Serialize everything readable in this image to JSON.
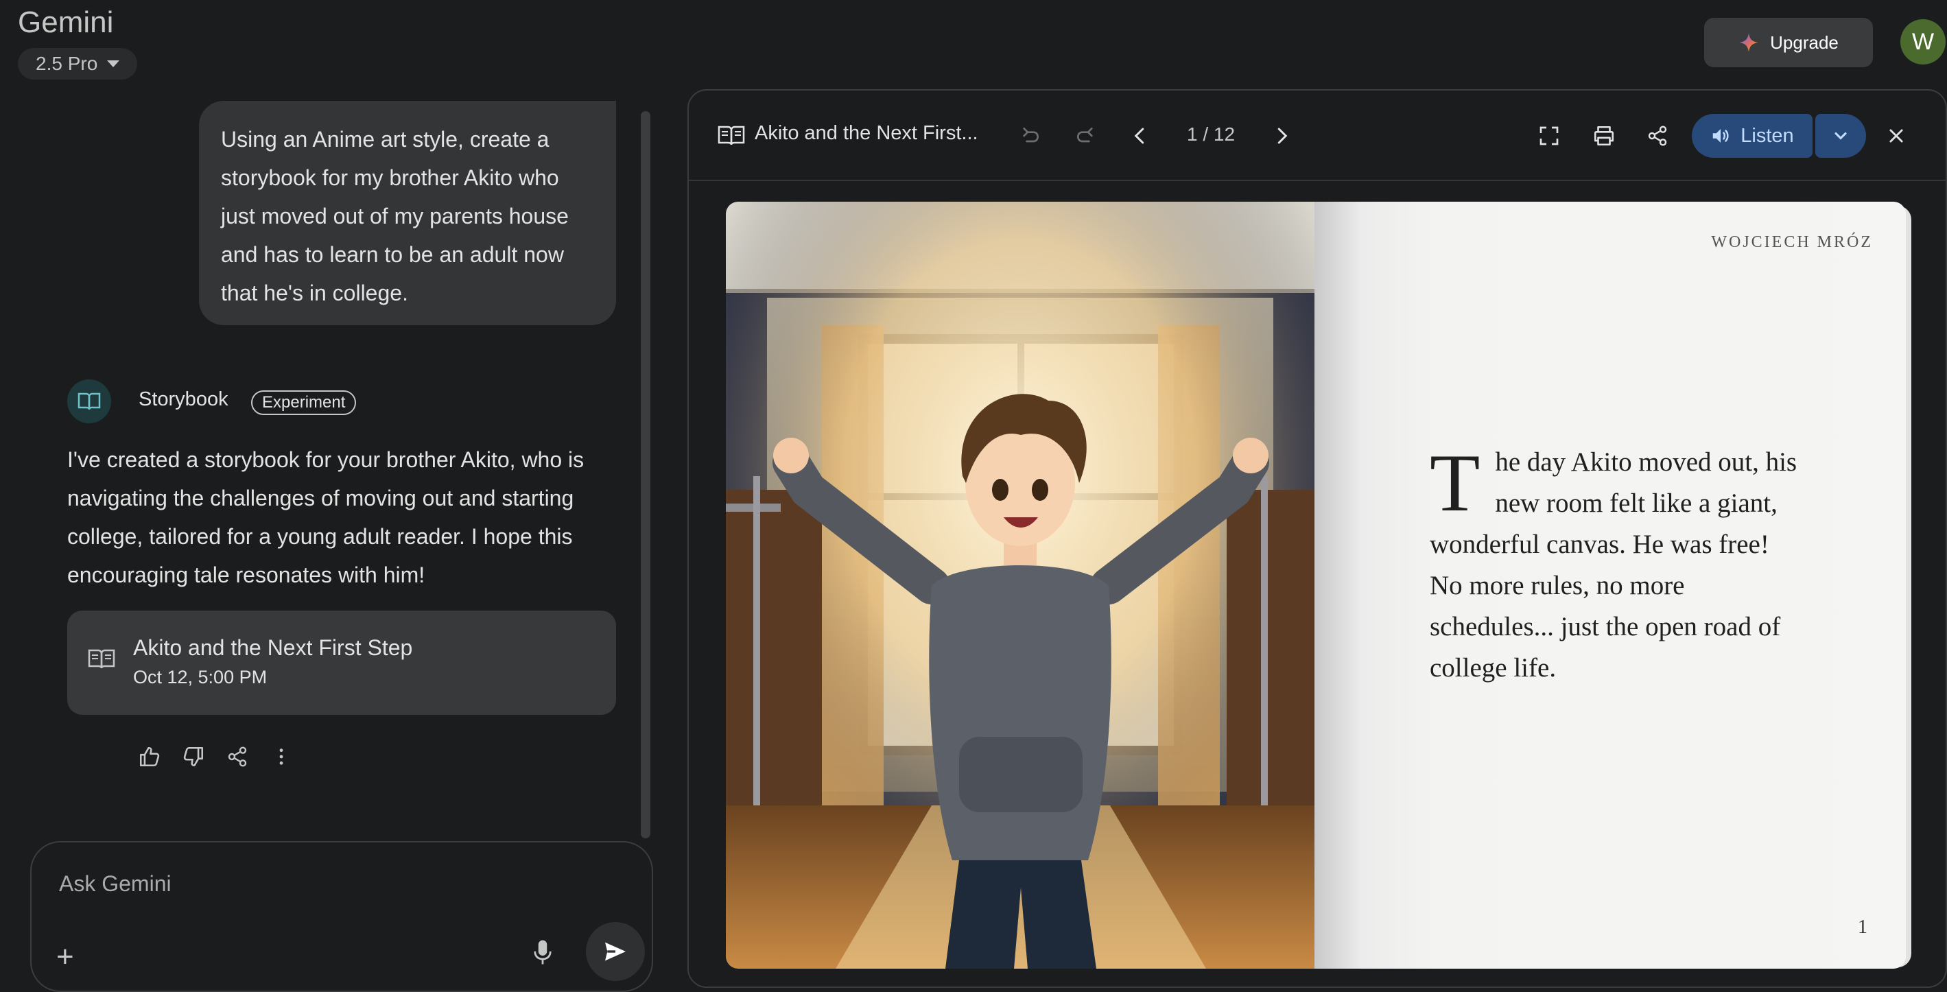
{
  "header": {
    "app_title": "Gemini",
    "model": "2.5 Pro",
    "upgrade_label": "Upgrade",
    "avatar_initial": "W"
  },
  "chat": {
    "user_message": "Using an Anime art style, create a storybook for my brother Akito who just moved out of my parents house and has to learn to be an adult now that he's in college.",
    "assistant_name": "Storybook",
    "assistant_badge": "Experiment",
    "assistant_response": "I've created a storybook for your brother Akito, who is navigating the challenges of moving out and starting college, tailored for a young adult reader. I hope this encouraging tale resonates with him!",
    "card": {
      "title": "Akito and the Next First Step",
      "date": "Oct 12, 5:00 PM"
    }
  },
  "input": {
    "placeholder": "Ask Gemini"
  },
  "viewer": {
    "title": "Akito and the Next First...",
    "page_indicator": "1 / 12",
    "listen_label": "Listen",
    "author": "WOJCIECH MRÓZ",
    "dropcap": "T",
    "page_text": "he day Akito moved out, his new room felt like a giant, wonderful canvas. He was free! No more rules, no more schedules... just the open road of college life.",
    "page_number": "1"
  }
}
